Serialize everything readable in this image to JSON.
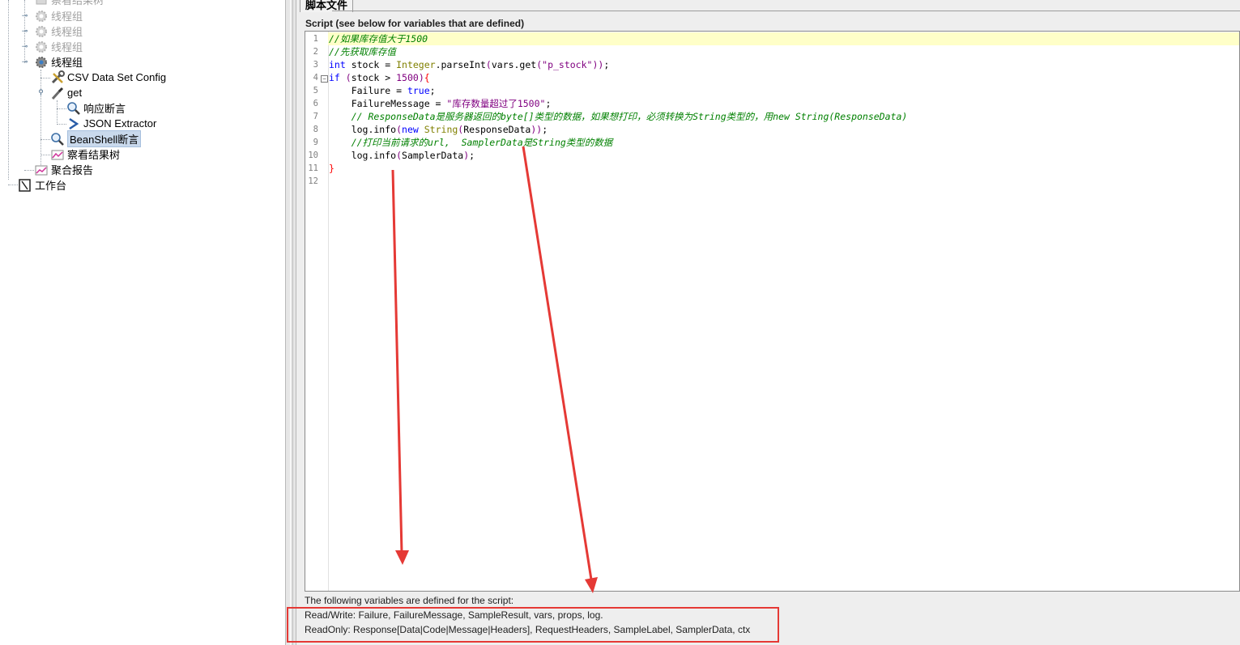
{
  "tree": {
    "items": [
      {
        "label": "察看结果树",
        "disabled": true,
        "icon": "view-results-tree-icon"
      },
      {
        "label": "线程组",
        "disabled": true,
        "icon": "gear-icon"
      },
      {
        "label": "线程组",
        "disabled": true,
        "icon": "gear-icon"
      },
      {
        "label": "线程组",
        "disabled": true,
        "icon": "gear-icon"
      },
      {
        "label": "线程组",
        "disabled": false,
        "icon": "gear-icon"
      },
      {
        "label": "CSV Data Set Config",
        "disabled": false,
        "icon": "wrench-icon"
      },
      {
        "label": "get",
        "disabled": false,
        "icon": "pipette-icon"
      },
      {
        "label": "响应断言",
        "disabled": false,
        "icon": "magnifier-icon"
      },
      {
        "label": "JSON Extractor",
        "disabled": false,
        "icon": "extractor-arrow-icon"
      },
      {
        "label": "BeanShell断言",
        "disabled": false,
        "icon": "magnifier-icon",
        "selected": true
      },
      {
        "label": "察看结果树",
        "disabled": false,
        "icon": "view-results-tree-icon"
      },
      {
        "label": "聚合报告",
        "disabled": false,
        "icon": "chart-icon"
      },
      {
        "label": "工作台",
        "disabled": false,
        "icon": "workbench-icon"
      }
    ]
  },
  "panel": {
    "tab_label": "脚本文件",
    "script_title": "Script (see below for variables that are defined)"
  },
  "editor": {
    "line_numbers": [
      "1",
      "2",
      "3",
      "4",
      "5",
      "6",
      "7",
      "8",
      "9",
      "10",
      "11",
      "12"
    ],
    "lines": [
      "//如果库存值大于1500",
      "//先获取库存值",
      "int stock = Integer.parseInt(vars.get(\"p_stock\"));",
      "if (stock > 1500){",
      "    Failure = true;",
      "    FailureMessage = \"库存数量超过了1500\";",
      "    // ResponseData是服务器返回的byte[]类型的数据，如果想打印，必须转换为String类型的，用new String(ResponseData)",
      "    log.info(new String(ResponseData));",
      "    //打印当前请求的url,  SamplerData是String类型的数据",
      "    log.info(SamplerData);",
      "}",
      ""
    ]
  },
  "variables": {
    "intro": "The following variables are defined for the script:",
    "read_write": "Read/Write: Failure, FailureMessage, SampleResult, vars, props, log.",
    "read_only": "ReadOnly: Response[Data|Code|Message|Headers], RequestHeaders, SampleLabel, SamplerData, ctx"
  },
  "annotation": {
    "color": "#e53935"
  }
}
